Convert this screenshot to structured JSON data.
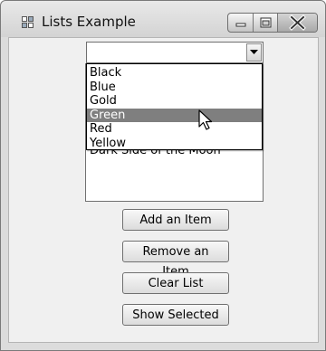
{
  "window": {
    "title": "Lists Example",
    "icon": "app-window-icon",
    "caption_buttons": [
      "minimize-icon",
      "maximize-icon",
      "close-icon"
    ]
  },
  "combo": {
    "value": "",
    "dropdown_open": true,
    "options": [
      "Black",
      "Blue",
      "Gold",
      "Green",
      "Red",
      "Yellow"
    ],
    "highlighted": "Green"
  },
  "listbox": {
    "items": [
      "Dark Side of the Moon"
    ]
  },
  "buttons": {
    "add": "Add an Item",
    "remove": "Remove an Item",
    "clear": "Clear List",
    "show": "Show Selected"
  },
  "colors": {
    "highlight": "#7f7f7f",
    "window_bg": "#f0f0f0"
  }
}
